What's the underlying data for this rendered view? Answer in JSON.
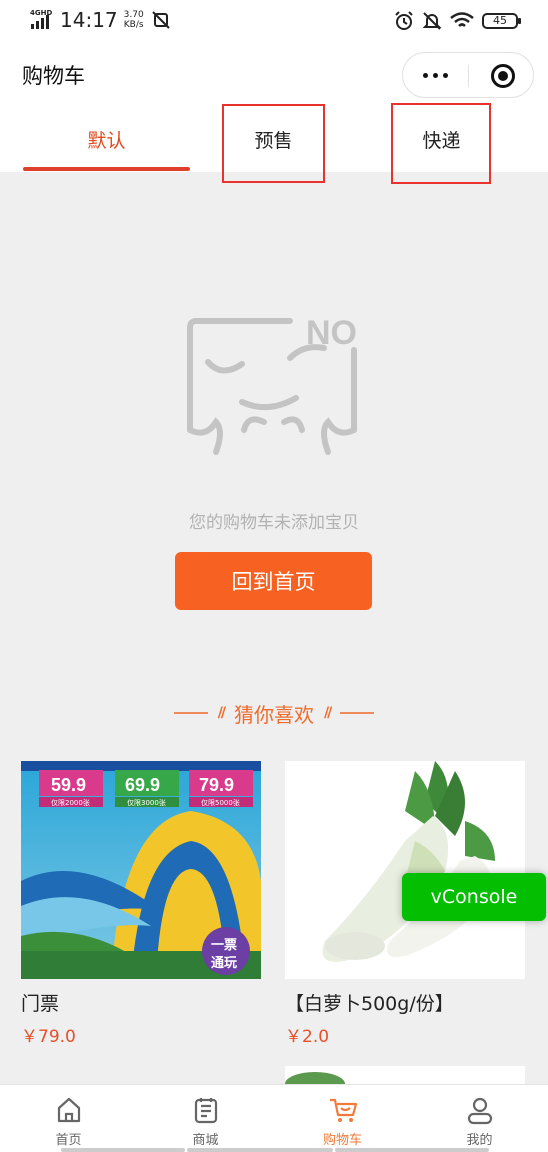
{
  "status_bar": {
    "network": "4GHD",
    "time": "14:17",
    "speed_value": "3.70",
    "speed_unit": "KB/s",
    "battery": "45",
    "icons": [
      "signal-icon",
      "alarm-icon",
      "mute-icon",
      "wifi-icon",
      "battery-icon"
    ]
  },
  "header": {
    "title": "购物车",
    "capsule_icons": [
      "more-icon",
      "close-target-icon"
    ]
  },
  "tabs": [
    {
      "label": "默认",
      "active": true
    },
    {
      "label": "预售",
      "active": false
    },
    {
      "label": "快递",
      "active": false
    }
  ],
  "empty_state": {
    "icon_text": "NO",
    "message": "您的购物车未添加宝贝",
    "button_label": "回到首页"
  },
  "recommend": {
    "title": "猜你喜欢",
    "products": [
      {
        "name": "门票",
        "price": "￥79.0"
      },
      {
        "name": "【白萝卜500g/份】",
        "price": "￥2.0"
      }
    ],
    "ticket_banner": {
      "prices": [
        "59.9",
        "69.9",
        "79.9"
      ],
      "limits": [
        "仅限2000张",
        "仅限3000张",
        "仅限5000张"
      ],
      "badge_line1": "一票",
      "badge_line2": "通玩"
    }
  },
  "debug": {
    "vconsole_label": "vConsole"
  },
  "tab_bar": {
    "items": [
      {
        "label": "首页",
        "icon": "home-icon",
        "active": false
      },
      {
        "label": "商城",
        "icon": "mall-icon",
        "active": false
      },
      {
        "label": "购物车",
        "icon": "cart-icon",
        "active": true
      },
      {
        "label": "我的",
        "icon": "user-icon",
        "active": false
      }
    ]
  },
  "colors": {
    "accent": "#f76223",
    "tab_active": "#e04b1f",
    "price": "#e5502a",
    "highlight_box": "#e8322d",
    "vconsole": "#04be02"
  }
}
